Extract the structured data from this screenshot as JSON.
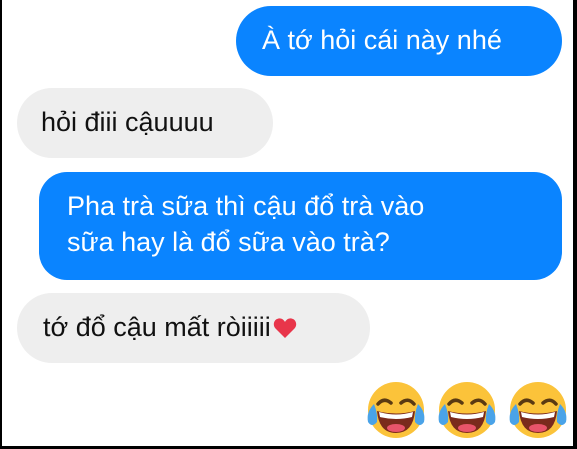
{
  "messages": [
    {
      "id": "m1",
      "side": "sent",
      "text": "À tớ hỏi cái này nhé"
    },
    {
      "id": "m2",
      "side": "received",
      "text": "hỏi điii cậuuuu"
    },
    {
      "id": "m3",
      "side": "sent",
      "lines": [
        "Pha trà sữa thì cậu đổ trà vào",
        "sữa hay là đổ sữa vào trà?"
      ]
    },
    {
      "id": "m4",
      "side": "received",
      "text": "tớ đổ cậu mất ròiiiii",
      "trailing_icon": "red-heart-emoji"
    }
  ],
  "reaction_emojis": [
    "face-with-tears-of-joy",
    "face-with-tears-of-joy",
    "face-with-tears-of-joy"
  ],
  "colors": {
    "sent_bubble": "#0a84ff",
    "received_bubble": "#eeeeee",
    "heart": "#e8354a",
    "emoji_face": "#fbc33a"
  }
}
